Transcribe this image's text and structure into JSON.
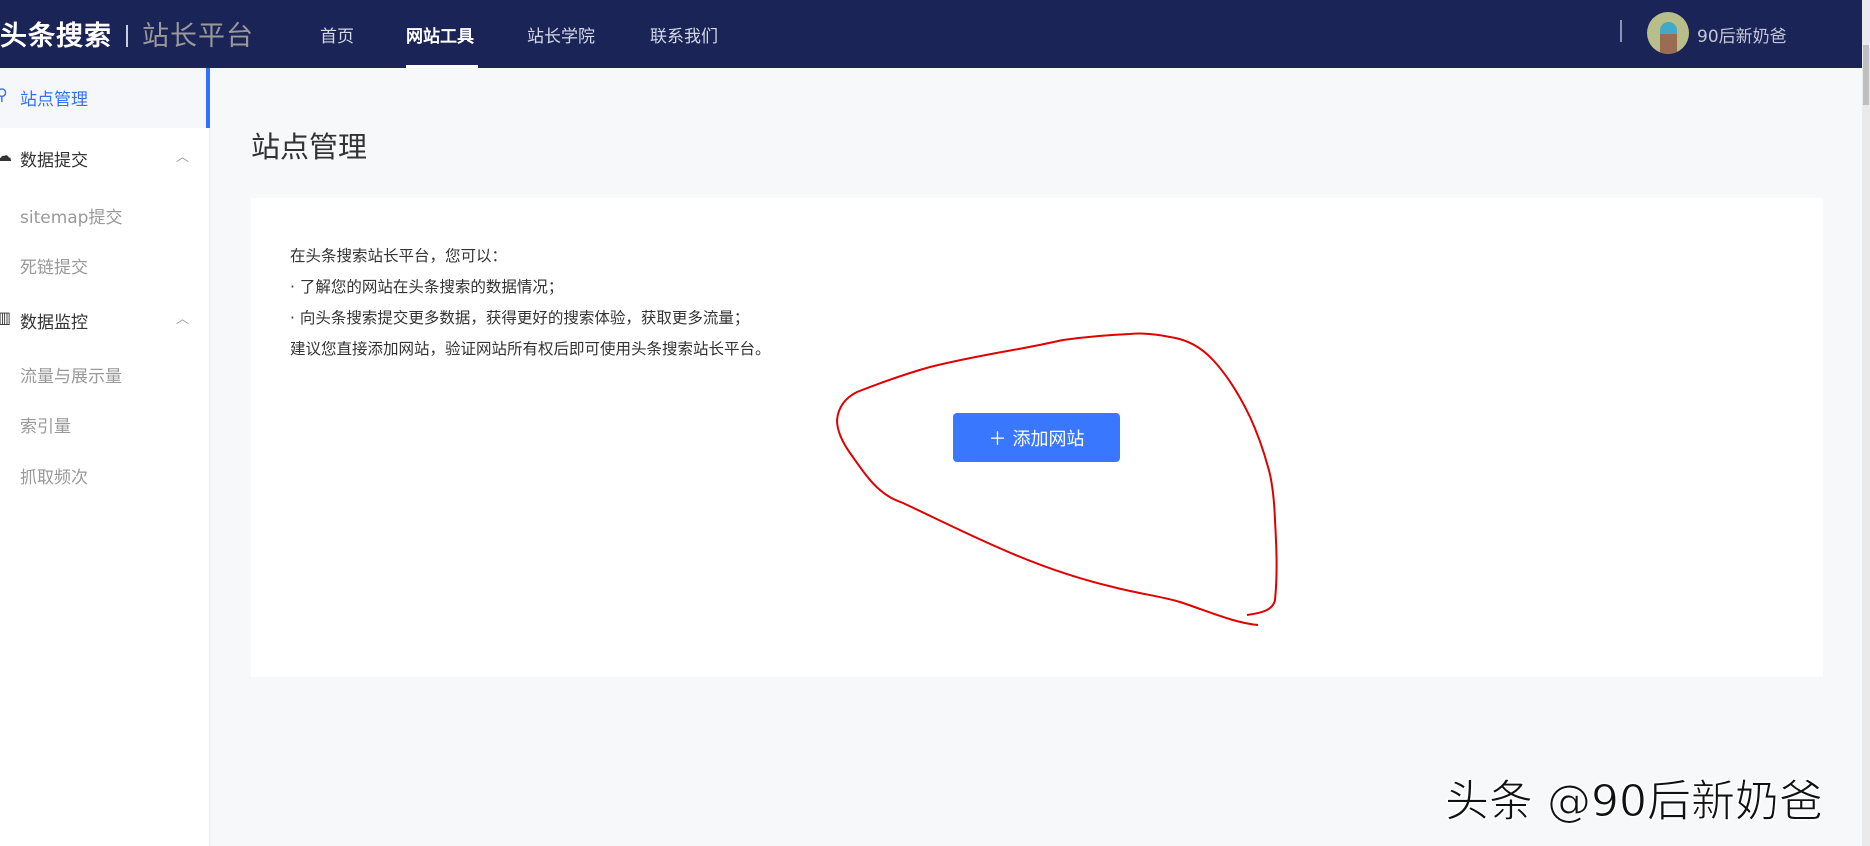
{
  "header": {
    "logo_main": "头条搜索",
    "logo_sub": "站长平台",
    "nav": [
      "首页",
      "网站工具",
      "站长学院",
      "联系我们"
    ],
    "username": "90后新奶爸"
  },
  "sidebar": {
    "items": [
      {
        "label": "站点管理"
      },
      {
        "label": "数据提交"
      },
      {
        "label": "sitemap提交"
      },
      {
        "label": "死链提交"
      },
      {
        "label": "数据监控"
      },
      {
        "label": "流量与展示量"
      },
      {
        "label": "索引量"
      },
      {
        "label": "抓取频次"
      }
    ]
  },
  "main": {
    "title": "站点管理",
    "lines": [
      "在头条搜索站长平台，您可以：",
      "· 了解您的网站在头条搜索的数据情况；",
      "· 向头条搜索提交更多数据，获得更好的搜索体验，获取更多流量；",
      "建议您直接添加网站，验证网站所有权后即可使用头条搜索站长平台。"
    ],
    "add_button": "添加网站",
    "add_icon": "＋"
  },
  "watermark": "头条 @90后新奶爸",
  "colors": {
    "header": "#1b2456",
    "accent": "#3370ff",
    "annotation": "#e00000"
  }
}
